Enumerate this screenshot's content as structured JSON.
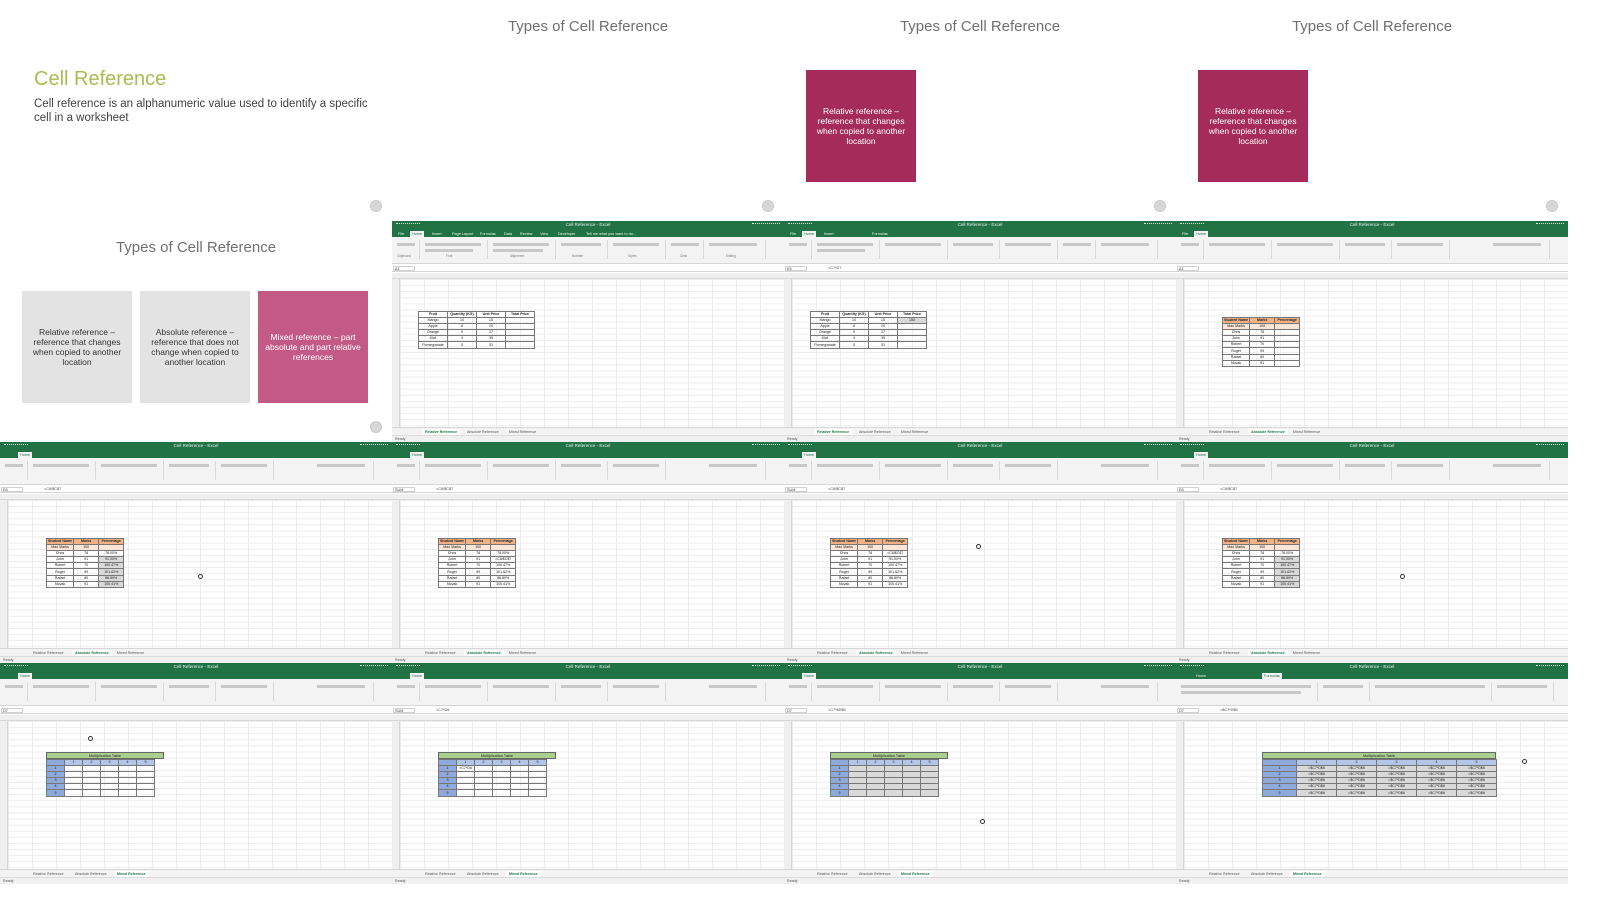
{
  "slides": {
    "heading": "Types of Cell Reference",
    "cell_reference": {
      "title": "Cell Reference",
      "description": "Cell reference is an alphanumeric value used to identify a specific cell in a worksheet"
    },
    "relative_box": "Relative reference – reference that changes when copied to another location",
    "absolute_box": "Absolute reference – reference that does not change when copied to another location",
    "mixed_box": "Mixed reference – part absolute and part relative references"
  },
  "excel": {
    "window_title": "Cell Reference - Excel",
    "ribbon_tabs": [
      "File",
      "Home",
      "Insert",
      "Page Layout",
      "Formulas",
      "Data",
      "Review",
      "View",
      "Developer",
      "Tell me what you want to do..."
    ],
    "ribbon_groups": [
      "Clipboard",
      "Font",
      "Alignment",
      "Number",
      "Styles",
      "Cells",
      "Editing"
    ],
    "sheet_tabs": [
      "Relative Reference",
      "Absolute Reference",
      "Mixed Reference"
    ],
    "status_ready": "Ready",
    "fruit_table": {
      "headers": [
        "Fruit",
        "Quantity (KG)",
        "Unit Price",
        "Total Price"
      ],
      "rows": [
        [
          "Mango",
          "10",
          "15",
          ""
        ],
        [
          "Apple",
          "8",
          "20",
          ""
        ],
        [
          "Orange",
          "9",
          "17",
          ""
        ],
        [
          "Kiwi",
          "4",
          "35",
          ""
        ],
        [
          "Pomegranate",
          "5",
          "31",
          ""
        ]
      ]
    },
    "student_table": {
      "headers": [
        "Student Name",
        "Marks",
        "Percentage"
      ],
      "max_row": [
        "Max Marks",
        "100",
        ""
      ],
      "rows": [
        [
          "Chris",
          "78",
          "78.00%"
        ],
        [
          "John",
          "91",
          "91.00%"
        ],
        [
          "Robert",
          "70",
          "100.47%"
        ],
        [
          "Roger",
          "99",
          "101.62%"
        ],
        [
          "Rafael",
          "80",
          "88.89%"
        ],
        [
          "Novak",
          "91",
          "100.41%"
        ]
      ]
    },
    "multiplication_table": {
      "title": "Multiplication Table",
      "col_values": [
        "1",
        "2",
        "3",
        "4",
        "5"
      ],
      "row_values": [
        "1",
        "2",
        "3",
        "4",
        "5"
      ]
    },
    "formulas": [
      "=C7*D7",
      "=C8/$C$7",
      "=C7*D6",
      "=C7*$D$6",
      "=$C7*D$6"
    ]
  }
}
